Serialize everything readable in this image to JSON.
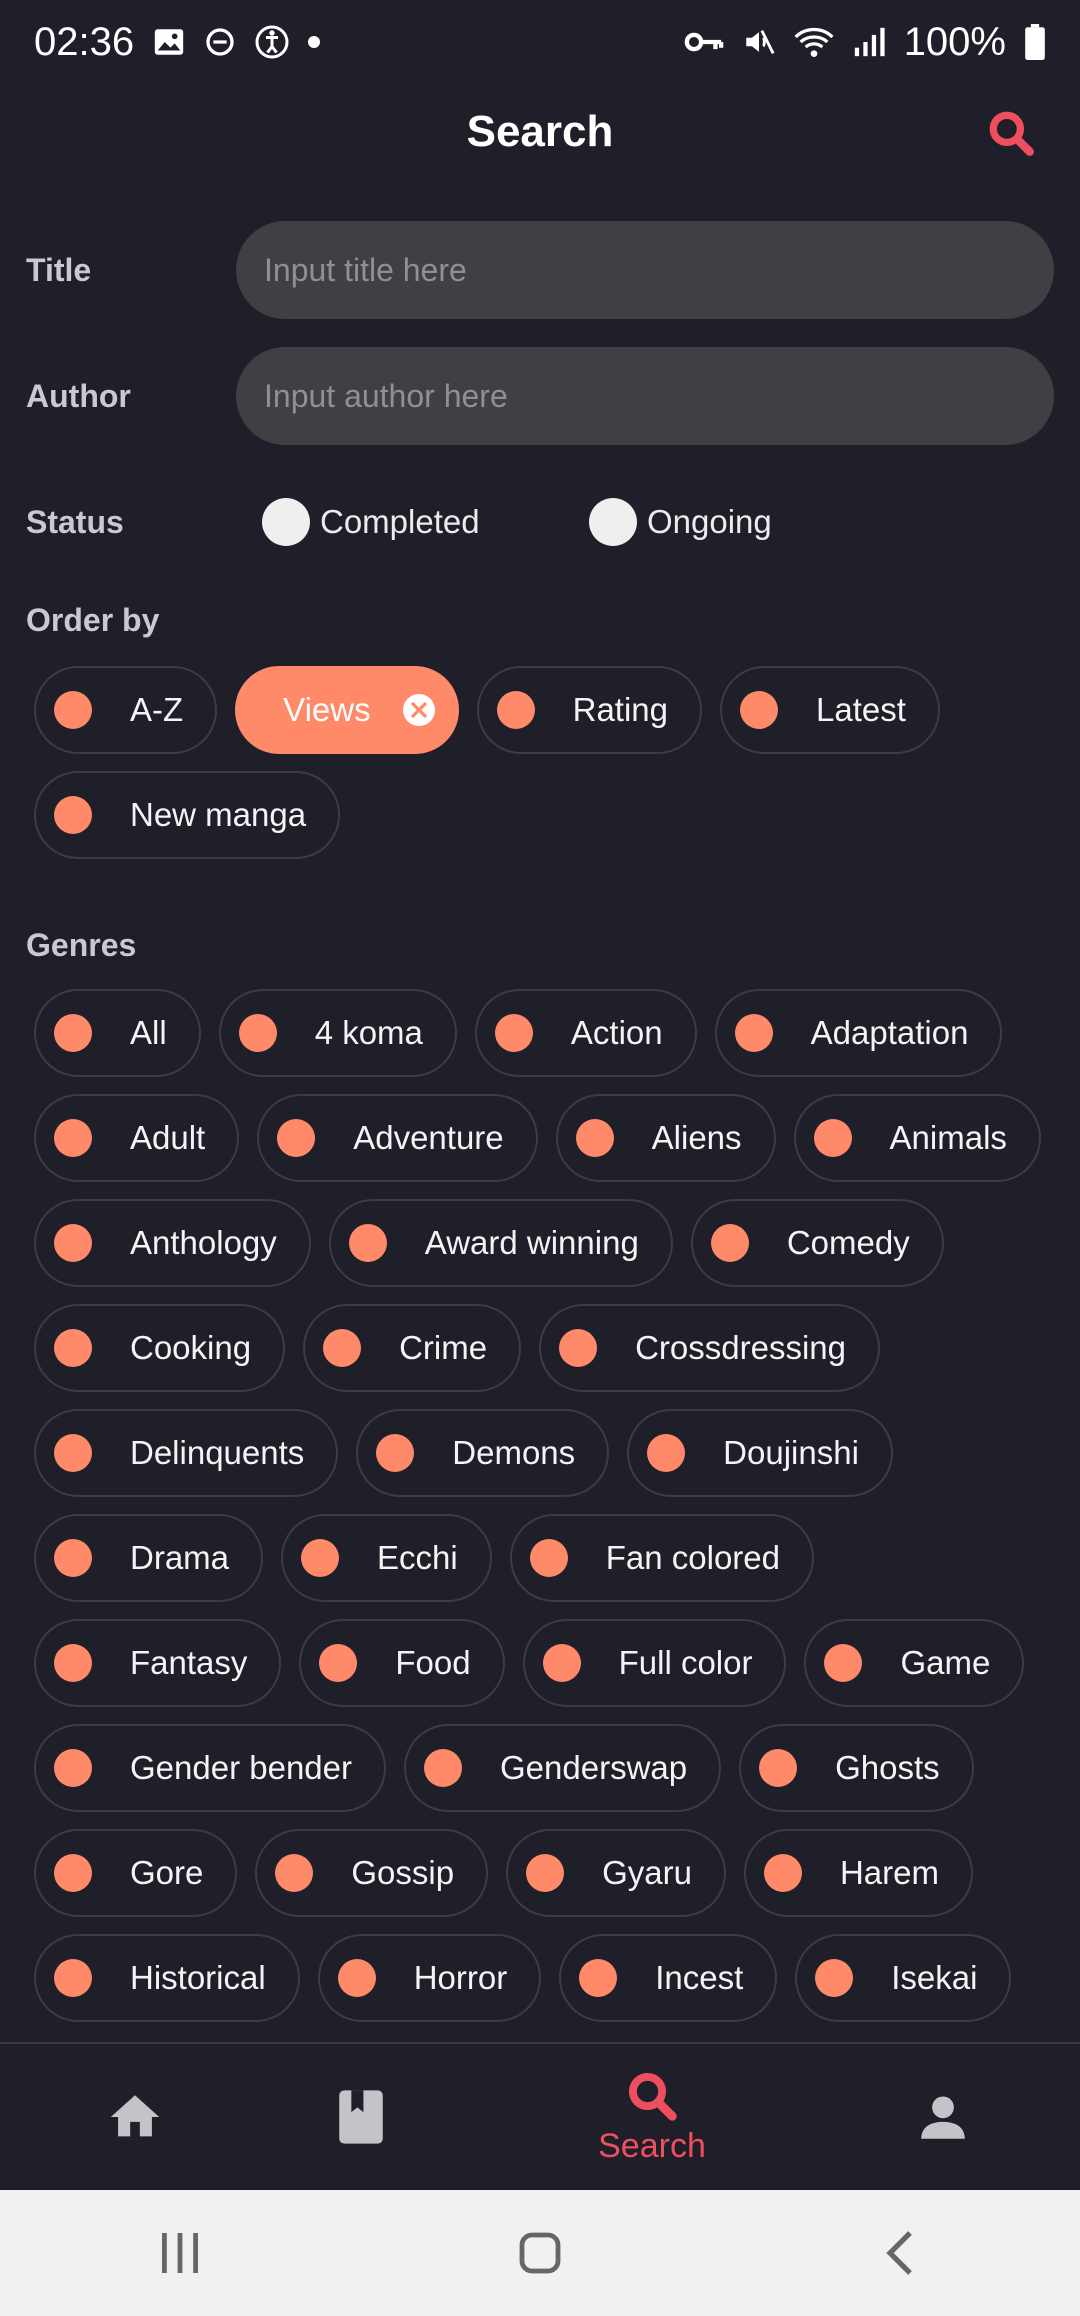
{
  "status_bar": {
    "time": "02:36",
    "battery": "100%"
  },
  "header": {
    "title": "Search"
  },
  "form": {
    "title_label": "Title",
    "title_placeholder": "Input title here",
    "author_label": "Author",
    "author_placeholder": "Input author here",
    "status_label": "Status",
    "status_options": [
      "Completed",
      "Ongoing"
    ]
  },
  "order_by": {
    "label": "Order by",
    "options": [
      "A-Z",
      "Views",
      "Rating",
      "Latest",
      "New manga"
    ],
    "selected": "Views"
  },
  "genres": {
    "label": "Genres",
    "items": [
      "All",
      "4 koma",
      "Action",
      "Adaptation",
      "Adult",
      "Adventure",
      "Aliens",
      "Animals",
      "Anthology",
      "Award winning",
      "Comedy",
      "Cooking",
      "Crime",
      "Crossdressing",
      "Delinquents",
      "Demons",
      "Doujinshi",
      "Drama",
      "Ecchi",
      "Fan colored",
      "Fantasy",
      "Food",
      "Full color",
      "Game",
      "Gender bender",
      "Genderswap",
      "Ghosts",
      "Gore",
      "Gossip",
      "Gyaru",
      "Harem",
      "Historical",
      "Horror",
      "Incest",
      "Isekai"
    ]
  },
  "bottom_nav": {
    "items": [
      {
        "icon": "home-icon",
        "label": ""
      },
      {
        "icon": "book-icon",
        "label": ""
      },
      {
        "icon": "search-icon",
        "label": "Search"
      },
      {
        "icon": "profile-icon",
        "label": ""
      }
    ],
    "active": "Search"
  },
  "colors": {
    "background": "#1f1f29",
    "accent": "#ff8a6a",
    "active_red": "#ef4e5f",
    "input_bg": "#3f3f44"
  }
}
